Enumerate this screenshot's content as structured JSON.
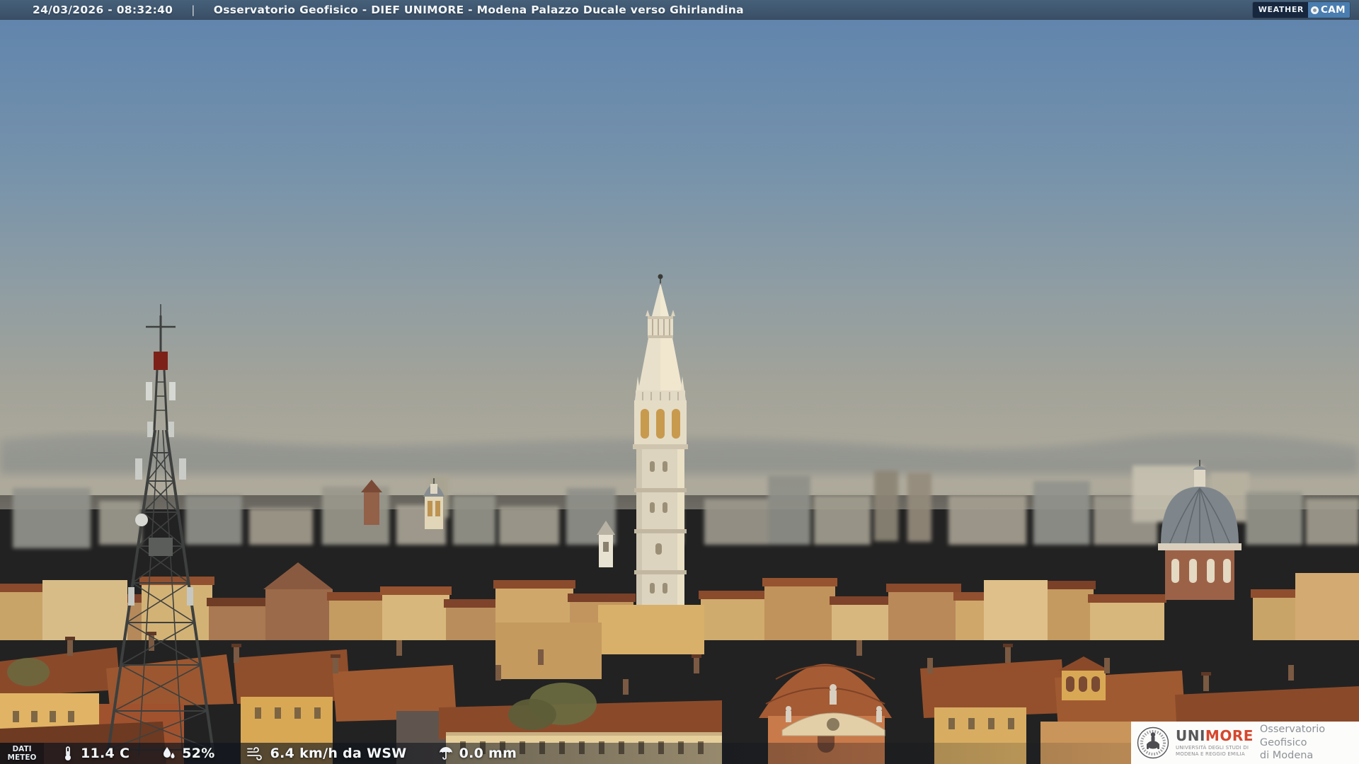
{
  "top_bar": {
    "datetime": "24/03/2026 - 08:32:40",
    "separator": "|",
    "title": "Osservatorio Geofisico - DIEF UNIMORE - Modena Palazzo Ducale verso Ghirlandina"
  },
  "weathercam_logo": {
    "weather": "WEATHER",
    "cam": "CAM",
    "icon": "camera-lens-icon"
  },
  "weather_bar": {
    "label_line1": "DATI",
    "label_line2": "METEO",
    "items": [
      {
        "icon": "thermometer-icon",
        "value": "11.4 C"
      },
      {
        "icon": "humidity-icon",
        "value": "52%"
      },
      {
        "icon": "wind-icon",
        "value": "6.4 km/h da WSW"
      },
      {
        "icon": "rain-icon",
        "value": "0.0 mm"
      }
    ]
  },
  "brand_box": {
    "uni": "UNI",
    "more": "MORE",
    "university_line1": "UNIVERSITÀ DEGLI STUDI DI",
    "university_line2": "MODENA E REGGIO EMILIA",
    "observatory_line1": "Osservatorio Geofisico",
    "observatory_line2": "di Modena"
  },
  "scene": {
    "palette": {
      "sky_top": "#5e83ad",
      "sky_haze": "#aaa79a",
      "roof_terracotta": "#96522e",
      "facade_ochre": "#dcb268",
      "tower_stone": "#e7dfc9",
      "dome_grey": "#7e868c",
      "topbar_blue": "#40566d",
      "accent_red": "#d5472e"
    }
  }
}
